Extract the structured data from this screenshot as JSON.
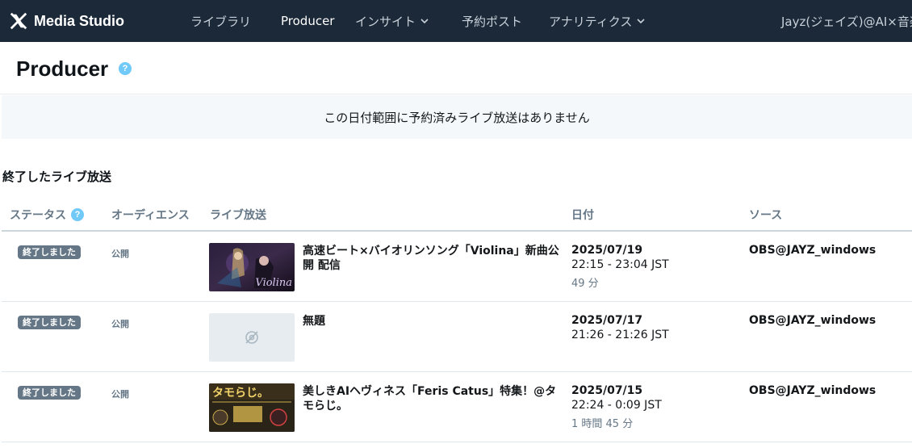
{
  "app": {
    "logo_text": "Media Studio",
    "nav": {
      "library": "ライブラリ",
      "producer": "Producer",
      "insights": "インサイト",
      "scheduled_posts": "予約ポスト",
      "analytics": "アナリティクス"
    },
    "account_name": "Jayz(ジェイズ)@AI×音楽"
  },
  "page": {
    "title": "Producer",
    "help_glyph": "?",
    "empty_message": "この日付範囲に予約済みライブ放送はありません",
    "section_title": "終了したライブ放送"
  },
  "table": {
    "headers": {
      "status": "ステータス",
      "audience": "オーディエンス",
      "broadcast": "ライブ放送",
      "date": "日付",
      "source": "ソース"
    },
    "rows": [
      {
        "status": "終了しました",
        "audience": "公開",
        "title": "高速ビート×バイオリンソング「Violina」新曲公開 配信",
        "thumb_text": "Violina",
        "date": "2025/07/19",
        "time": "22:15 - 23:04 JST",
        "duration": "49 分",
        "source": "OBS@JAYZ_windows"
      },
      {
        "status": "終了しました",
        "audience": "公開",
        "title": "無題",
        "thumb_text": "",
        "date": "2025/07/17",
        "time": "21:26 - 21:26 JST",
        "duration": "",
        "source": "OBS@JAYZ_windows"
      },
      {
        "status": "終了しました",
        "audience": "公開",
        "title": "美しきAIヘヴィネス「Feris Catus」特集！@タモらじ。",
        "thumb_text": "タモらじ。",
        "date": "2025/07/15",
        "time": "22:24 - 0:09 JST",
        "duration": "1 時間 45 分",
        "source": "OBS@JAYZ_windows"
      }
    ]
  },
  "colors": {
    "topbar": "#1c2938",
    "help_icon": "#71c9f8",
    "badge": "#657786"
  },
  "icons": [
    "x-logo-icon",
    "chevron-down-icon",
    "help-icon",
    "no-image-icon"
  ]
}
